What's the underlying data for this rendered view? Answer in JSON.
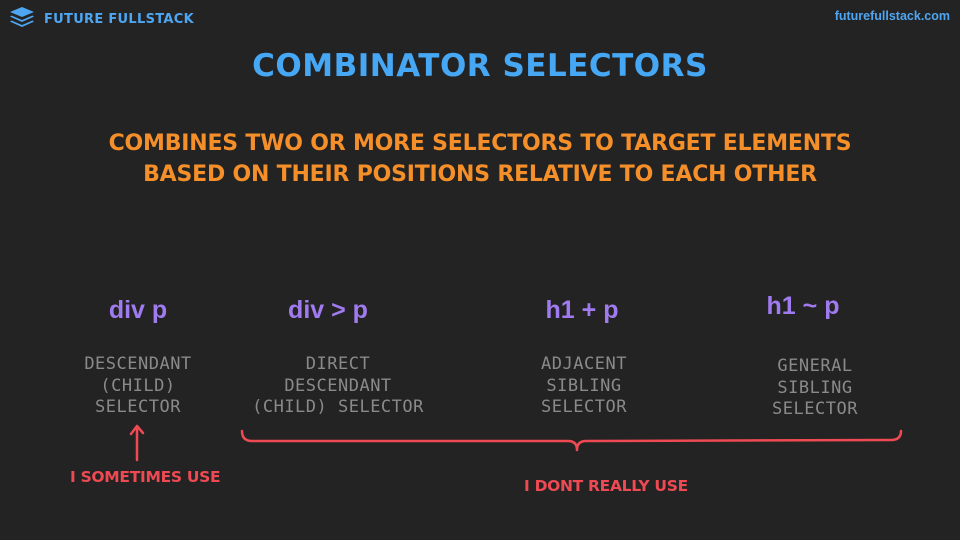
{
  "brand": {
    "name": "FUTURE FULLSTACK",
    "url": "futurefullstack.com",
    "logo_icon": "layers-stack-icon",
    "accent_color": "#4ea6f2"
  },
  "slide": {
    "title": "Combinator Selectors",
    "subtitle_lines": [
      "Combines two or more selectors to target elements",
      "based on their positions relative to each other"
    ],
    "selectors": [
      {
        "syntax": "div p",
        "description_lines": [
          "Descendant",
          "(child)",
          "selector"
        ]
      },
      {
        "syntax": "div > p",
        "description_lines": [
          "Direct",
          "descendant",
          "(child) selector"
        ]
      },
      {
        "syntax": "h1 + p",
        "description_lines": [
          "Adjacent",
          "sibling",
          "selector"
        ]
      },
      {
        "syntax": "h1 ~ p",
        "description_lines": [
          "General",
          "sibling",
          "selector"
        ]
      }
    ],
    "annotations": {
      "sometimes_use": "I sometimes use",
      "dont_really_use": "I dont really use"
    },
    "colors": {
      "background": "#232323",
      "title": "#46a7f5",
      "subtitle": "#f48f2a",
      "syntax": "#a07bf0",
      "description": "#8a8a8a",
      "annotation": "#ef4a53"
    }
  }
}
